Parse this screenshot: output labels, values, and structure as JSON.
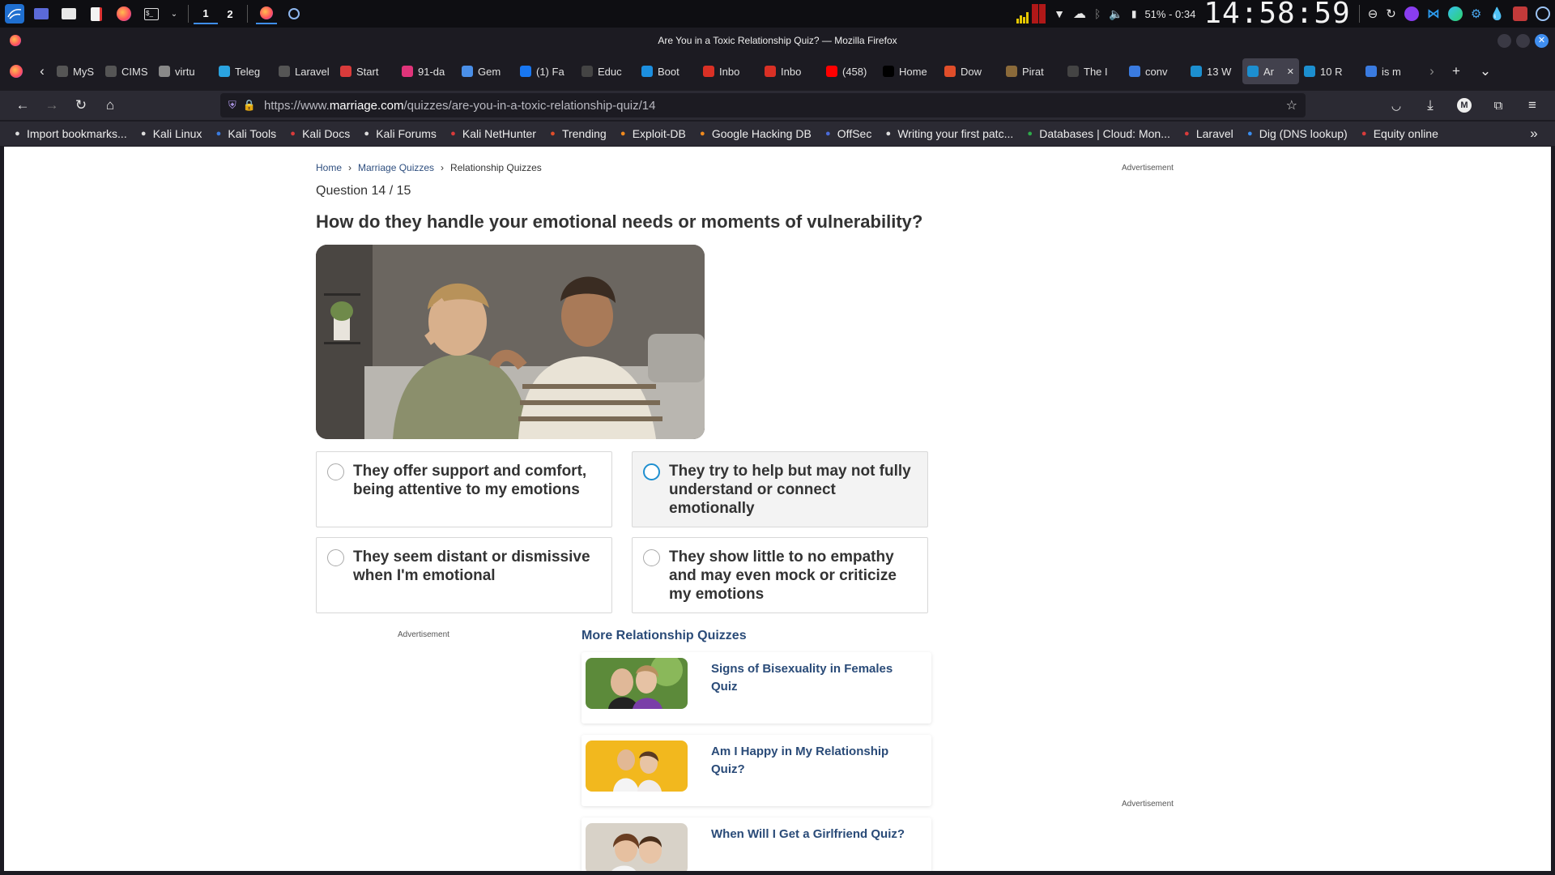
{
  "os_panel": {
    "workspaces": [
      "1",
      "2"
    ],
    "battery": "51% - 0:34",
    "clock": "14:58:59"
  },
  "window": {
    "title": "Are You in a Toxic Relationship Quiz? — Mozilla Firefox"
  },
  "tabs": [
    {
      "label": "MyS",
      "color": "#555555",
      "icon": "generic-icon"
    },
    {
      "label": "CIMS",
      "color": "#555555",
      "icon": "generic-icon"
    },
    {
      "label": "virtu",
      "color": "#888888",
      "icon": "page-icon"
    },
    {
      "label": "Teleg",
      "color": "#2aa3e0",
      "icon": "telegram-icon"
    },
    {
      "label": "Laravel",
      "color": "#555555",
      "icon": "generic-icon"
    },
    {
      "label": "Start",
      "color": "#d93b3b",
      "icon": "laravel-icon"
    },
    {
      "label": "91-da",
      "color": "#e0347a",
      "icon": "slack-icon"
    },
    {
      "label": "Gem",
      "color": "#4a8fe8",
      "icon": "gemini-icon"
    },
    {
      "label": "(1) Fa",
      "color": "#1877f2",
      "icon": "facebook-icon"
    },
    {
      "label": "Educ",
      "color": "#444444",
      "icon": "chatgpt-icon"
    },
    {
      "label": "Boot",
      "color": "#1c8fe0",
      "icon": "mdb-icon"
    },
    {
      "label": "Inbo",
      "color": "#d93025",
      "icon": "gmail-icon"
    },
    {
      "label": "Inbo",
      "color": "#d93025",
      "icon": "gmail-icon"
    },
    {
      "label": "(458)",
      "color": "#ff0000",
      "icon": "youtube-icon"
    },
    {
      "label": "Home",
      "color": "#000000",
      "icon": "x-icon"
    },
    {
      "label": "Dow",
      "color": "#e04e2a",
      "icon": "x-mark-icon"
    },
    {
      "label": "Pirat",
      "color": "#8a6a3a",
      "icon": "pirate-icon"
    },
    {
      "label": "The I",
      "color": "#444444",
      "icon": "page-icon"
    },
    {
      "label": "conv",
      "color": "#3a7be0",
      "icon": "search-icon"
    },
    {
      "label": "13 W",
      "color": "#1c8fd0",
      "icon": "marriage-icon"
    },
    {
      "label": "Ar",
      "color": "#1c8fd0",
      "icon": "marriage-icon"
    },
    {
      "label": "10 R",
      "color": "#1c8fd0",
      "icon": "marriage-icon"
    },
    {
      "label": "is m",
      "color": "#3a7be0",
      "icon": "search-icon"
    }
  ],
  "urlbar": {
    "url_prefix": "https://www.",
    "url_domain": "marriage.com",
    "url_path": "/quizzes/are-you-in-a-toxic-relationship-quiz/14"
  },
  "bookmarks": [
    {
      "label": "Import bookmarks...",
      "icon": "import-icon"
    },
    {
      "label": "Kali Linux",
      "icon": "kali-icon"
    },
    {
      "label": "Kali Tools",
      "icon": "kali-tools-icon"
    },
    {
      "label": "Kali Docs",
      "icon": "kali-docs-icon"
    },
    {
      "label": "Kali Forums",
      "icon": "kali-icon"
    },
    {
      "label": "Kali NetHunter",
      "icon": "nethunter-icon"
    },
    {
      "label": "Trending",
      "icon": "trending-icon"
    },
    {
      "label": "Exploit-DB",
      "icon": "exploitdb-icon"
    },
    {
      "label": "Google Hacking DB",
      "icon": "ghdb-icon"
    },
    {
      "label": "OffSec",
      "icon": "offsec-icon"
    },
    {
      "label": "Writing your first patc...",
      "icon": "globe-icon"
    },
    {
      "label": "Databases | Cloud: Mon...",
      "icon": "mongodb-icon"
    },
    {
      "label": "Laravel",
      "icon": "laravel-icon"
    },
    {
      "label": "Dig (DNS lookup)",
      "icon": "dig-icon"
    },
    {
      "label": "Equity online",
      "icon": "equity-icon"
    }
  ],
  "page": {
    "breadcrumb": [
      "Home",
      "Marriage Quizzes",
      "Relationship Quizzes"
    ],
    "ad_label": "Advertisement",
    "question_count": "Question 14 / 15",
    "question": "How do they handle your emotional needs or moments of vulnerability?",
    "options": [
      {
        "text": "They offer support and comfort, being attentive to my emotions",
        "selected": false
      },
      {
        "text": "They try to help but may not fully understand or connect emotionally",
        "selected": true
      },
      {
        "text": "They seem distant or dismissive when I'm emotional",
        "selected": false
      },
      {
        "text": "They show little to no empathy and may even mock or criticize my emotions",
        "selected": false
      }
    ],
    "more_title": "More Relationship Quizzes",
    "related": [
      {
        "title": "Signs of Bisexuality in Females Quiz"
      },
      {
        "title": "Am I Happy in My Relationship Quiz?"
      },
      {
        "title": "When Will I Get a Girlfriend Quiz?"
      }
    ]
  },
  "colors": {
    "accent": "#1f8fd0",
    "link": "#2a4b78",
    "browser_bg": "#1c1b22",
    "toolbar_bg": "#2b2a33"
  }
}
